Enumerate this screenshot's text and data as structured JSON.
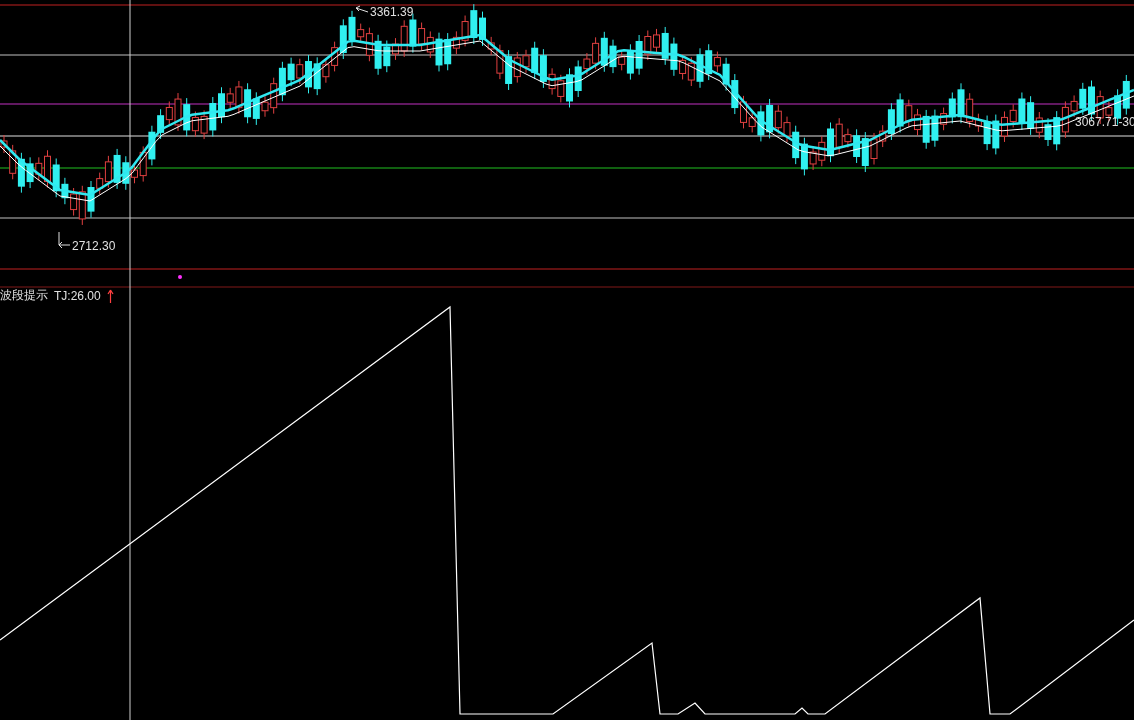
{
  "price_panel": {
    "high_label": "3361.39",
    "low_label": "2712.30",
    "range_label": "3067.71-30"
  },
  "indicator_panel": {
    "name": "波段提示",
    "reading": "TJ:26.00"
  }
}
